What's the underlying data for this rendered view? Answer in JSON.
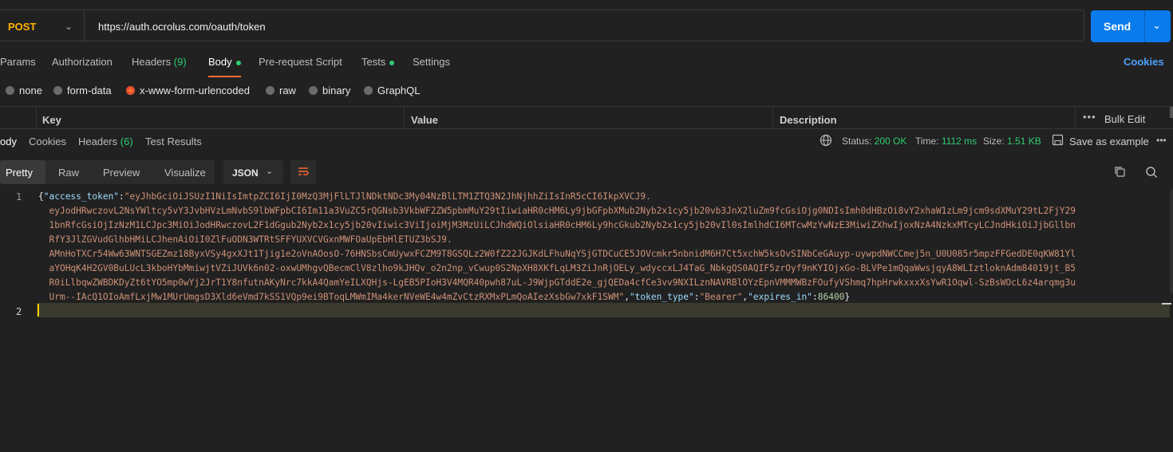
{
  "request": {
    "method": "POST",
    "url": "https://auth.ocrolus.com/oauth/token",
    "send_label": "Send"
  },
  "request_tabs": [
    {
      "label": "Params"
    },
    {
      "label": "Authorization"
    },
    {
      "label": "Headers",
      "count": "(9)"
    },
    {
      "label": "Body"
    },
    {
      "label": "Pre-request Script"
    },
    {
      "label": "Tests"
    },
    {
      "label": "Settings"
    }
  ],
  "cookies_label": "Cookies",
  "body_types": [
    "none",
    "form-data",
    "x-www-form-urlencoded",
    "raw",
    "binary",
    "GraphQL"
  ],
  "kv_header": {
    "key": "Key",
    "value": "Value",
    "description": "Description",
    "bulk_edit": "Bulk Edit",
    "more": "•••"
  },
  "response_tabs": [
    {
      "label": "ody"
    },
    {
      "label": "Cookies"
    },
    {
      "label": "Headers",
      "count": "(6)"
    },
    {
      "label": "Test Results"
    }
  ],
  "response_status": {
    "status_label": "Status:",
    "status_value": "200 OK",
    "time_label": "Time:",
    "time_value": "1112 ms",
    "size_label": "Size:",
    "size_value": "1.51 KB",
    "save_label": "Save as example",
    "more": "•••"
  },
  "format_tabs": [
    "Pretty",
    "Raw",
    "Preview",
    "Visualize"
  ],
  "format_select": "JSON",
  "code": {
    "line_numbers": [
      "1",
      "2"
    ],
    "open": "{",
    "key_access": "\"access_token\"",
    "colon": ":",
    "token_lines": [
      "\"eyJhbGciOiJSUzI1NiIsImtpZCI6IjI0MzQ3MjFlLTJlNDktNDc3My04NzBlLTM1ZTQ3N2JhNjhhZiIsInR5cCI6IkpXVCJ9.",
      "eyJodHRwczovL2NsYWltcy5vY3JvbHVzLmNvbS9lbWFpbCI6Im11a3VuZC5rQGNsb3VkbWF2ZW5pbmMuY29tIiwiaHR0cHM6Ly9jbGFpbXMub2Nyb2x1cy5jb20vb3JnX2luZm9fcGsiOjg0NDIsImh0dHBzOi8vY2xhaW1zLm9jcm9sdXMuY29tL2FjY29",
      "1bnRfcGsiOjIzNzM1LCJpc3MiOiJodHRwczovL2F1dGgub2Nyb2x1cy5jb20vIiwic3ViIjoiMjM3MzUiLCJhdWQiOlsiaHR0cHM6Ly9hcGkub2Nyb2x1cy5jb20vIl0sImlhdCI6MTcwMzYwNzE3MiwiZXhwIjoxNzA4NzkxMTcyLCJndHkiOiJjbGllbn",
      "RfY3JlZGVudGlhbHMiLCJhenAiOiI0ZlFuODN3WTRtSFFYUXVCVGxnMWFOaUpEbHlETUZ3bSJ9.",
      "AMnHoTXCr54Ww63WNTSGEZmz18ByxVSy4gxXJt1Tjig1e2oVnAOosO-76HNSbsCmUywxFCZM9T8GSQLz2W0fZ22JGJKdLFhuNqYSjGTDCuCE5JOVcmkr5nbnidM6H7Ct5xchW5ksOvSINbCeGAuyp-uywpdNWCCmej5n_U0U085r5mpzFFGedDE0qKW81Yl",
      "aYOHqK4H2GV0BuLUcL3kboHYbMmiwjtVZiJUVk6n02-oxwUMhgvQBecmClV8zlho9kJHQv_o2n2np_vCwup0S2NpXH8XKfLqLM3ZiJnRjOELy_wdyccxLJ4TaG_NbkgQS0AQIF5zrOyf9nKYIOjxGo-BLVPe1mQqaWwsjqyA8WLIztloknAdm84019jt_B5",
      "R0iLlbqwZWBDKDyZt6tYO5mp0wYj2JrT1Y8nfutnAKyNrc7kkA4QamYeILXQHjs-LgEB5PIoH3V4MQR40pwh87uL-J9WjpGTddE2e_gjQEDa4cfCe3vv9NXILznNAVRBlOYzEpnVMMMWBzFOufyVShmq7hpHrwkxxxXsYwR1Oqwl-SzBsWOcL6z4arqmg3u",
      "Urm--IAcQ1OIoAmfLxjMw1MUrUmgsD3Xld6eVmd7kSS1VQp9ei9BToqLMWmIMa4kerNVeWE4w4mZvCtzRXMxPLmQoAIezXsbGw7xkF1SWM\""
    ],
    "comma": ",",
    "key_type": "\"token_type\"",
    "val_type": "\"Bearer\"",
    "key_expires": "\"expires_in\"",
    "val_expires": "86400",
    "close": "}"
  }
}
